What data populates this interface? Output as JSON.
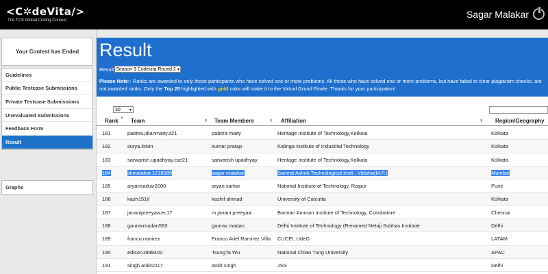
{
  "header": {
    "logo": "<C✲deVita/>",
    "logo_sub": "The TCS Global Coding Contest",
    "user_name": "Sagar Malakar"
  },
  "sidebar": {
    "status": "Your Contest has Ended",
    "items": [
      {
        "label": "Guidelines"
      },
      {
        "label": "Public Testcase Submissions"
      },
      {
        "label": "Private Testcase Submissions"
      },
      {
        "label": "Unevaluated Submissions"
      },
      {
        "label": "Feedback Form"
      },
      {
        "label": "Result"
      }
    ],
    "graphs": "Graphs"
  },
  "main": {
    "title": "Result",
    "round_label": "Result",
    "round_value": "Season 9 Codevita Round 2",
    "note_prefix": "Please Note:-",
    "note_text1": " Ranks are awarded to only those participants who have solved one or more problems. All those who have solved one or more problems, but have failed to clear plagiarism checks, are not awarded ranks. Only the ",
    "note_top": "Top 25",
    "note_text2": " highlighted with ",
    "note_gold": "gold",
    "note_text3": " color will make it to the Virtual Grand Finale. Thanks for your participation!"
  },
  "table": {
    "page_size": "30",
    "search_placeholder": "",
    "headers": {
      "rank": "Rank",
      "team": "Team",
      "members": "Team Members",
      "affiliation": "Affiliation",
      "region": "Region/Geography"
    },
    "rows": [
      {
        "rank": "181",
        "team": "pabitra.jibanmaity.it21",
        "members": "pabitra maity",
        "affiliation": "Heritage Institute of Technology,Kolkata",
        "region": "Kolkata"
      },
      {
        "rank": "182",
        "team": "surya.linkin",
        "members": "kumar pratap",
        "affiliation": "Kalinga Institute of Industrial Technology",
        "region": "Kolkata"
      },
      {
        "rank": "183",
        "team": "sarwarish.upadhyay.cse21",
        "members": "sarwarish upadhyay",
        "affiliation": "Heritage Institute of Technology,Kolkata",
        "region": "Kolkata"
      },
      {
        "rank": "184",
        "team": "skmalakar.1218089",
        "members": "sagar malakar",
        "affiliation": "Samrat Ashok Technological Instt., Vidisha(M.P.)",
        "region": "Mumbai"
      },
      {
        "rank": "185",
        "team": "aryansarkar2000",
        "members": "aryan sarkar",
        "affiliation": "National Institute of Technology, Raipur",
        "region": "Pune"
      },
      {
        "rank": "186",
        "team": "kash151if",
        "members": "kashif ahmad",
        "affiliation": "University of Calcutta",
        "region": "Kolkata"
      },
      {
        "rank": "187",
        "team": "jananipreeyaa.ec17",
        "members": "m janani preeyaa",
        "affiliation": "Bannari Amman Institute of Technology, Coimbatore",
        "region": "Chennai"
      },
      {
        "rank": "188",
        "team": "gauravmadan583",
        "members": "gaurav madan",
        "affiliation": "Delhi Institute of Technology (Renamed Netaji Subhas Institute",
        "region": "Delhi"
      },
      {
        "rank": "189",
        "team": "franco.ramirez",
        "members": "Franco Ariel Ramirez Villa",
        "affiliation": "CUCEI, UdeG",
        "region": "LATAM"
      },
      {
        "rank": "190",
        "team": "edison1998402",
        "members": "TsungTa Wu",
        "affiliation": "National Chiao Tung University",
        "region": "APAC"
      },
      {
        "rank": "191",
        "team": "singh.ankit2117",
        "members": "ankit singh",
        "affiliation": "JSS",
        "region": "Delhi"
      }
    ],
    "selected_rank": "184"
  }
}
